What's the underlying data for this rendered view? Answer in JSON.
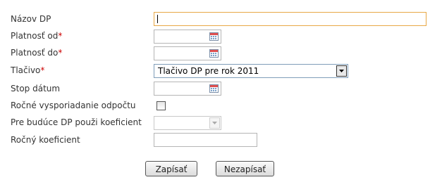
{
  "form": {
    "nazov": {
      "label": "Názov DP",
      "value": ""
    },
    "platnost_od": {
      "label": "Platnosť od",
      "required_mark": "*",
      "value": ""
    },
    "platnost_do": {
      "label": "Platnosť do",
      "required_mark": "*",
      "value": ""
    },
    "tlacivo": {
      "label": "Tlačivo",
      "required_mark": "*",
      "selected": "Tlačivo DP pre rok 2011"
    },
    "stop_datum": {
      "label": "Stop dátum",
      "value": ""
    },
    "rocne_vysporiadanie": {
      "label": "Ročné vysporiadanie odpočtu",
      "checked": false
    },
    "koeficient_select": {
      "label": "Pre budúce DP použi koeficient",
      "selected": ""
    },
    "rocny_koeficient": {
      "label": "Ročný koeficient",
      "value": ""
    }
  },
  "buttons": {
    "save_label": "Zapísať",
    "cancel_label": "Nezapísať"
  },
  "icons": {
    "date_picker": "calendar-icon",
    "dropdown": "chevron-down-icon"
  },
  "colors": {
    "required": "#cc0000",
    "focus_border": "#e8a845",
    "calendar_accent": "#e05050"
  }
}
